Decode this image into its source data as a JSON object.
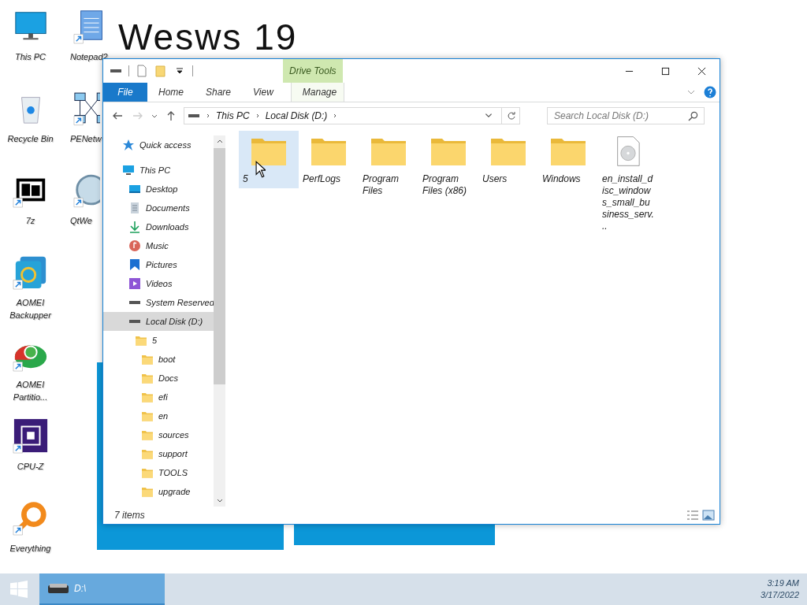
{
  "desktop": {
    "wallpaper_text": "Wesws 19",
    "columns": [
      [
        {
          "label": "This PC",
          "kind": "pc",
          "shortcut": false
        },
        {
          "label": "Recycle Bin",
          "kind": "bin",
          "shortcut": false
        },
        {
          "label": "7z",
          "kind": "archive",
          "shortcut": true
        },
        {
          "label": "AOMEI Backupper",
          "kind": "backup",
          "shortcut": true
        },
        {
          "label": "AOMEI Partitio...",
          "kind": "partition",
          "shortcut": true
        },
        {
          "label": "CPU-Z",
          "kind": "cpu",
          "shortcut": true
        },
        {
          "label": "Everything",
          "kind": "search",
          "shortcut": true
        }
      ],
      [
        {
          "label": "Notepad2",
          "kind": "notepad",
          "shortcut": true
        },
        {
          "label": "PENetw",
          "kind": "network",
          "shortcut": true
        },
        {
          "label": "QtWe",
          "kind": "qt",
          "shortcut": true
        }
      ]
    ]
  },
  "window": {
    "ribbon": {
      "context_group": "Drive Tools",
      "tabs": [
        {
          "label": "File",
          "kind": "file",
          "selected": false
        },
        {
          "label": "Home",
          "kind": "tab",
          "selected": false
        },
        {
          "label": "Share",
          "kind": "tab",
          "selected": false
        },
        {
          "label": "View",
          "kind": "tab",
          "selected": false
        },
        {
          "label": "Manage",
          "kind": "context",
          "selected": false
        }
      ]
    },
    "address": {
      "crumbs": [
        "This PC",
        "Local Disk (D:)"
      ]
    },
    "search": {
      "placeholder": "Search Local Disk (D:)"
    },
    "nav": {
      "items": [
        {
          "label": "Quick access",
          "kind": "star",
          "selected": false
        },
        {
          "label": "This PC",
          "kind": "pc",
          "selected": false,
          "children": [
            {
              "label": "Desktop",
              "kind": "desktop",
              "selected": false
            },
            {
              "label": "Documents",
              "kind": "documents",
              "selected": false
            },
            {
              "label": "Downloads",
              "kind": "downloads",
              "selected": false
            },
            {
              "label": "Music",
              "kind": "music",
              "selected": false
            },
            {
              "label": "Pictures",
              "kind": "pictures",
              "selected": false
            },
            {
              "label": "Videos",
              "kind": "videos",
              "selected": false
            },
            {
              "label": "System Reserved",
              "kind": "drive",
              "selected": false
            },
            {
              "label": "Local Disk (D:)",
              "kind": "drive",
              "selected": true,
              "children": [
                {
                  "label": "5",
                  "kind": "folder",
                  "selected": false,
                  "children": [
                    {
                      "label": "boot",
                      "kind": "folder",
                      "selected": false
                    },
                    {
                      "label": "Docs",
                      "kind": "folder",
                      "selected": false
                    },
                    {
                      "label": "efi",
                      "kind": "folder",
                      "selected": false
                    },
                    {
                      "label": "en",
                      "kind": "folder",
                      "selected": false
                    },
                    {
                      "label": "sources",
                      "kind": "folder",
                      "selected": false
                    },
                    {
                      "label": "support",
                      "kind": "folder",
                      "selected": false
                    },
                    {
                      "label": "TOOLS",
                      "kind": "folder",
                      "selected": false
                    },
                    {
                      "label": "upgrade",
                      "kind": "folder",
                      "selected": false
                    }
                  ]
                }
              ]
            }
          ]
        }
      ]
    },
    "files": [
      {
        "name": "5",
        "kind": "folder",
        "selected": true
      },
      {
        "name": "PerfLogs",
        "kind": "folder",
        "selected": false
      },
      {
        "name": "Program Files",
        "kind": "folder",
        "selected": false
      },
      {
        "name": "Program Files (x86)",
        "kind": "folder",
        "selected": false
      },
      {
        "name": "Users",
        "kind": "folder",
        "selected": false
      },
      {
        "name": "Windows",
        "kind": "folder",
        "selected": false
      },
      {
        "name": "en_install_disc_windows_small_business_serv...",
        "kind": "disc-image",
        "selected": false
      }
    ],
    "status": "7 items"
  },
  "taskbar": {
    "items": [
      {
        "label": "D:\\",
        "selected": true
      }
    ],
    "time": "3:19 AM",
    "date": "3/17/2022"
  }
}
